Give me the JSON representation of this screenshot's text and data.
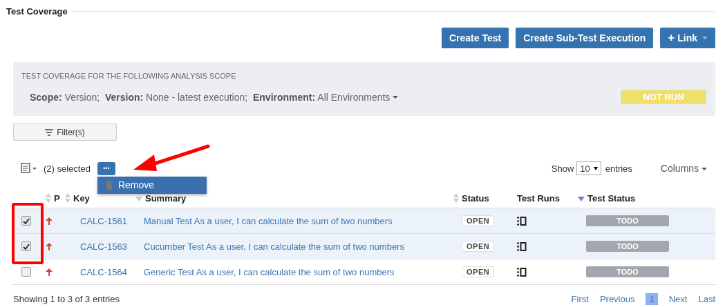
{
  "section": {
    "title": "Test Coverage"
  },
  "actions": [
    {
      "label": "Create Test",
      "kind": "plain"
    },
    {
      "label": "Create Sub-Test Execution",
      "kind": "plain"
    },
    {
      "label": "Link",
      "icon": "+",
      "kind": "dropdown"
    }
  ],
  "scope": {
    "heading": "TEST COVERAGE FOR THE FOLLOWING ANALYSIS SCOPE",
    "parts": [
      {
        "label": "Scope:",
        "value": "Version;"
      },
      {
        "label": "Version:",
        "value": "None - latest execution;"
      },
      {
        "label": "Environment:",
        "value": "All Environments"
      }
    ],
    "badge": "NOT RUN"
  },
  "filter": {
    "label": "Filter(s)"
  },
  "toolbar": {
    "selected_text": "(2) selected",
    "more": "•••",
    "menu": [
      {
        "label": "Remove"
      }
    ],
    "show": "Show",
    "page_size": "10",
    "entries": "entries",
    "columns": "Columns"
  },
  "table": {
    "columns": [
      {
        "label": "P",
        "sortable": true,
        "sorted": false
      },
      {
        "label": "Key",
        "sortable": true,
        "sorted": false
      },
      {
        "label": "Summary",
        "sortable": true,
        "sorted": true,
        "primary": false
      },
      {
        "label": "Status",
        "sortable": true,
        "sorted": false
      },
      {
        "label": "Test Runs",
        "sortable": false
      },
      {
        "label": "Test Status",
        "sortable": true,
        "sorted": true,
        "primary": true
      }
    ],
    "rows": [
      {
        "selected": true,
        "key": "CALC-1561",
        "summary": "Manual Test As a user, I can calculate the sum of two numbers",
        "status": "OPEN",
        "test_status": "TODO"
      },
      {
        "selected": true,
        "key": "CALC-1563",
        "summary": "Cucumber Test As a user, I can calculate the sum of two numbers",
        "status": "OPEN",
        "test_status": "TODO"
      },
      {
        "selected": false,
        "key": "CALC-1564",
        "summary": "Generic Test As a user, I can calculate the sum of two numbers",
        "status": "OPEN",
        "test_status": "TODO"
      }
    ]
  },
  "footer": {
    "info": "Showing 1 to 3 of 3 entries",
    "pages": [
      {
        "label": "First",
        "selected": false
      },
      {
        "label": "Previous",
        "selected": false
      },
      {
        "label": "1",
        "selected": true
      },
      {
        "label": "Next",
        "selected": false
      },
      {
        "label": "Last",
        "selected": false
      }
    ]
  }
}
